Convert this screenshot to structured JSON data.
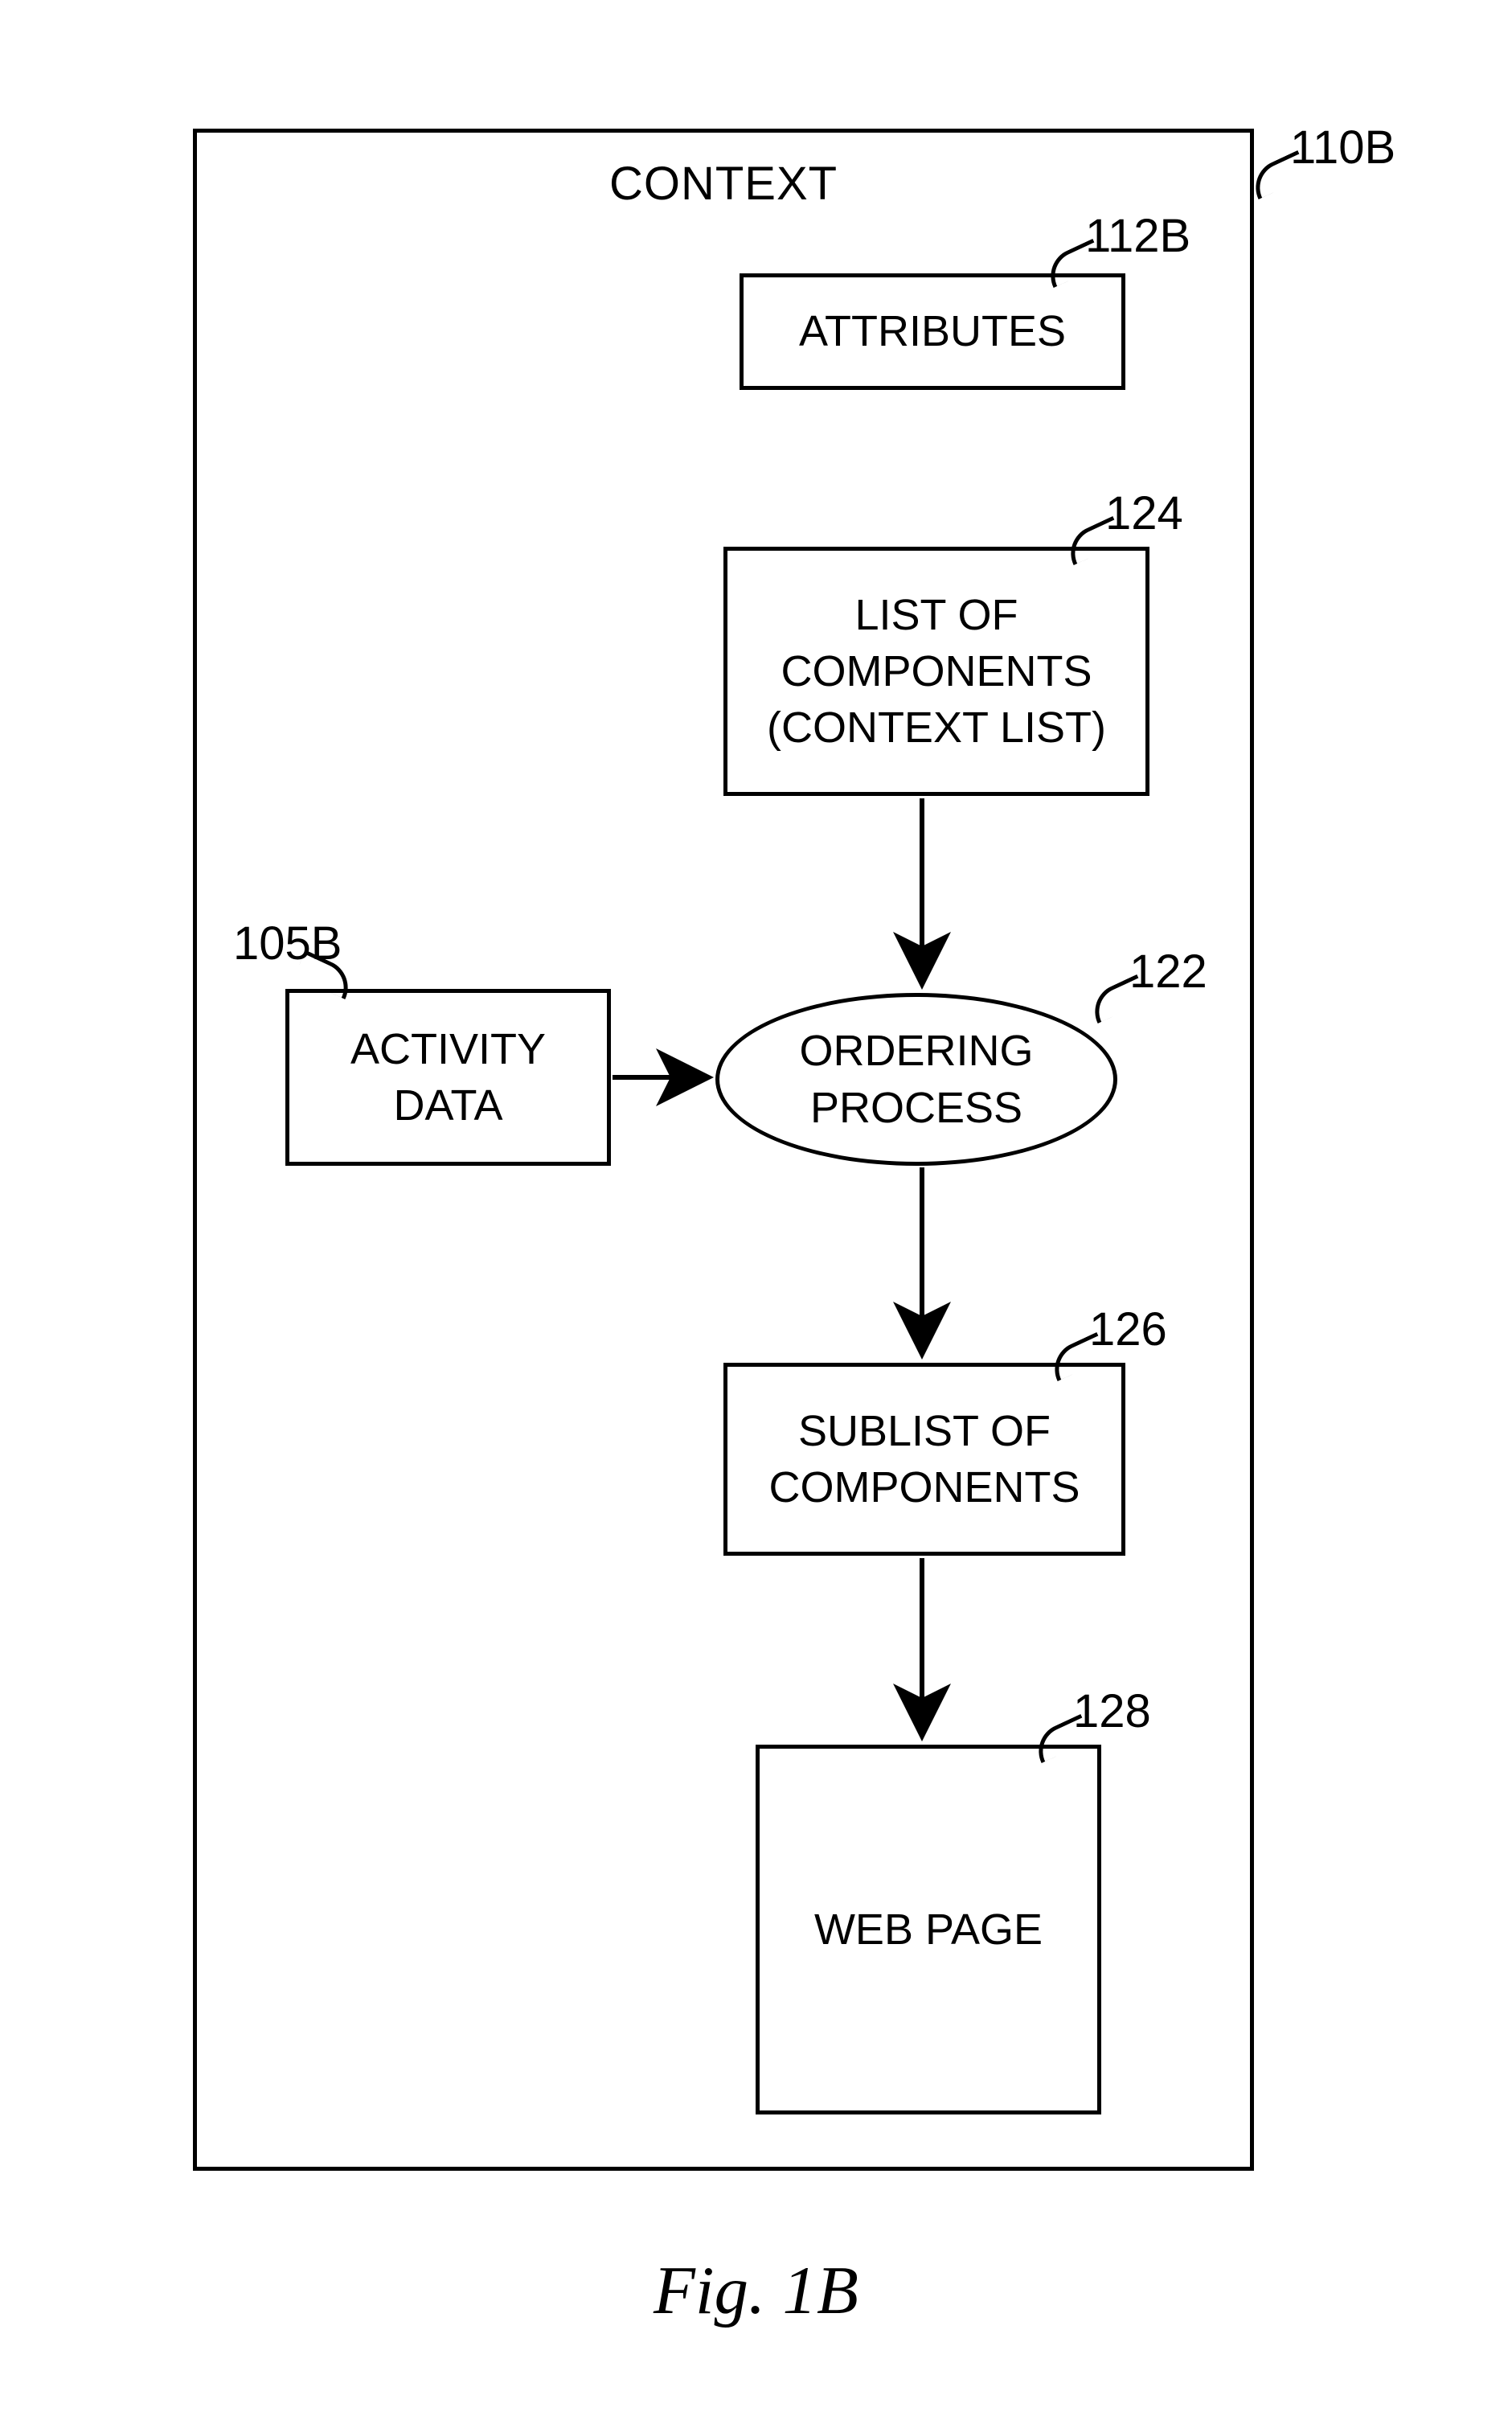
{
  "title": "CONTEXT",
  "boxes": {
    "attributes": "ATTRIBUTES",
    "list_of_components": "LIST OF\nCOMPONENTS\n(CONTEXT LIST)",
    "activity_data": "ACTIVITY\nDATA",
    "ordering_process": "ORDERING\nPROCESS",
    "sublist_of_components": "SUBLIST OF\nCOMPONENTS",
    "web_page": "WEB PAGE"
  },
  "refs": {
    "context": "110B",
    "attributes": "112B",
    "list_of_components": "124",
    "activity_data": "105B",
    "ordering_process": "122",
    "sublist_of_components": "126",
    "web_page": "128"
  },
  "caption": "Fig. 1B"
}
